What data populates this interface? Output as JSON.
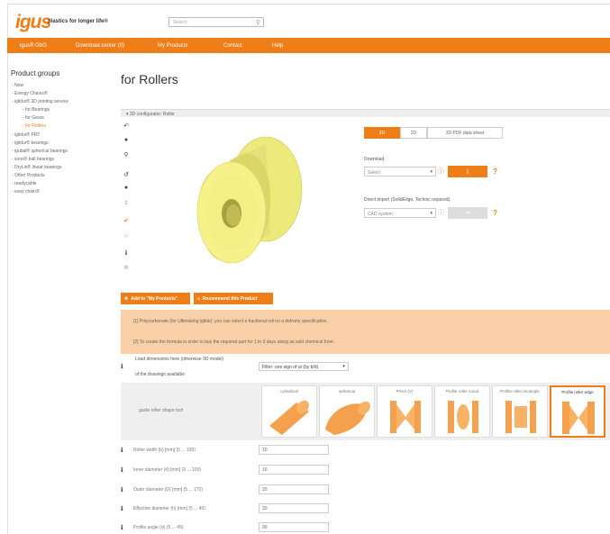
{
  "header": {
    "logo": "igus",
    "tagline": "plastics for longer life®",
    "search_placeholder": "Search"
  },
  "nav": {
    "items": [
      "igus® GbG",
      "Download center (0)",
      "My Products",
      "Contact",
      "Help"
    ]
  },
  "sidebar": {
    "title": "Product groups",
    "items": [
      {
        "label": "- New",
        "indent": 0
      },
      {
        "label": "- Energy Chains®",
        "indent": 0
      },
      {
        "label": "- iglidur® 3D printing service",
        "indent": 0
      },
      {
        "label": "- for Bearings",
        "indent": 1
      },
      {
        "label": "- for Gears",
        "indent": 1
      },
      {
        "label": "- for Rollers",
        "indent": 1,
        "active": true
      },
      {
        "label": "- iglidur® PRT",
        "indent": 0
      },
      {
        "label": "- iglidur® bearings",
        "indent": 0
      },
      {
        "label": "- igubal® spherical bearings",
        "indent": 0
      },
      {
        "label": "- xiros® ball bearings",
        "indent": 0
      },
      {
        "label": "- DryLin® linear bearings",
        "indent": 0
      },
      {
        "label": "- Other Products",
        "indent": 0
      },
      {
        "label": "- readycable",
        "indent": 0
      },
      {
        "label": "- easy chain®",
        "indent": 0
      }
    ]
  },
  "main": {
    "page_title": "for Rollers",
    "section_title": "▾ 3D configurator: Roller"
  },
  "viewer": {
    "view_tabs": [
      "3D",
      "2D",
      "3D PDF data sheet"
    ],
    "download_label": "Download",
    "format_value": "Select",
    "cad_label": "Direct import (SolidEdge, Technic required)",
    "cad_value": "CAD system"
  },
  "actions": {
    "add_label": "Add to \"My Products\"",
    "share_label": "Recommend this Product"
  },
  "notice": {
    "line1": "[1] Polycarbonate (for Ultimaking iglide): you can select a fractional roll on a delivery specification.",
    "line2": "[2] To create the formula in order to buy the required part for 1 to 3 days along as sold chemical from."
  },
  "config": {
    "intro1": "Load dimensions here (otherwise 3D model)",
    "intro2": "of the drawings available",
    "material_value": "Filter: one sign of ut (by b/d)",
    "profile_row_label": "guide roller shape tool",
    "profiles": [
      {
        "title": "cylindrical",
        "active": false
      },
      {
        "title": "spherical",
        "active": false
      },
      {
        "title": "Prism (V)",
        "active": false
      },
      {
        "title": "Profile roller round",
        "active": false
      },
      {
        "title": "Profile roller rectangle",
        "active": false
      },
      {
        "title": "Profile roller edge",
        "active": true
      }
    ],
    "dimensions": [
      {
        "label": "Roller width (b) [mm] (5 ... 100)",
        "value": "10"
      },
      {
        "label": "Inner diameter (d) [mm] (3 ... 100)",
        "value": "10"
      },
      {
        "label": "Outer diameter (D) [mm] (5 ... 175)",
        "value": "20"
      },
      {
        "label": "Effective diameter (h) [mm] (5 ... 40)",
        "value": "20"
      },
      {
        "label": "Profile angle (α) (5 ... 45)",
        "value": "90"
      }
    ]
  },
  "colors": {
    "accent": "#ef7d18",
    "notice_bg": "#f9cfa7",
    "roller": "#f3f07a"
  }
}
